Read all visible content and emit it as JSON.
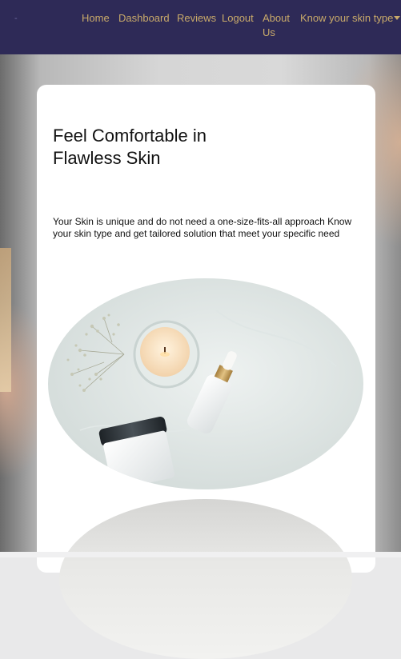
{
  "navbar": {
    "brand": "-",
    "links": [
      {
        "label": "Home"
      },
      {
        "label": "Dashboard"
      },
      {
        "label": "Reviews"
      },
      {
        "label": "Logout"
      },
      {
        "label": "About Us"
      },
      {
        "label": "Know your skin type"
      }
    ]
  },
  "hero": {
    "headline": "Feel Comfortable in Flawless Skin",
    "description": "Your Skin is unique and do not need a one-size-fits-all approach Know your skin type and get tailored solution that meet your specific need"
  },
  "colors": {
    "navbar_bg": "#2e2a57",
    "nav_link": "#c9aa6a",
    "card_bg": "#ffffff"
  }
}
